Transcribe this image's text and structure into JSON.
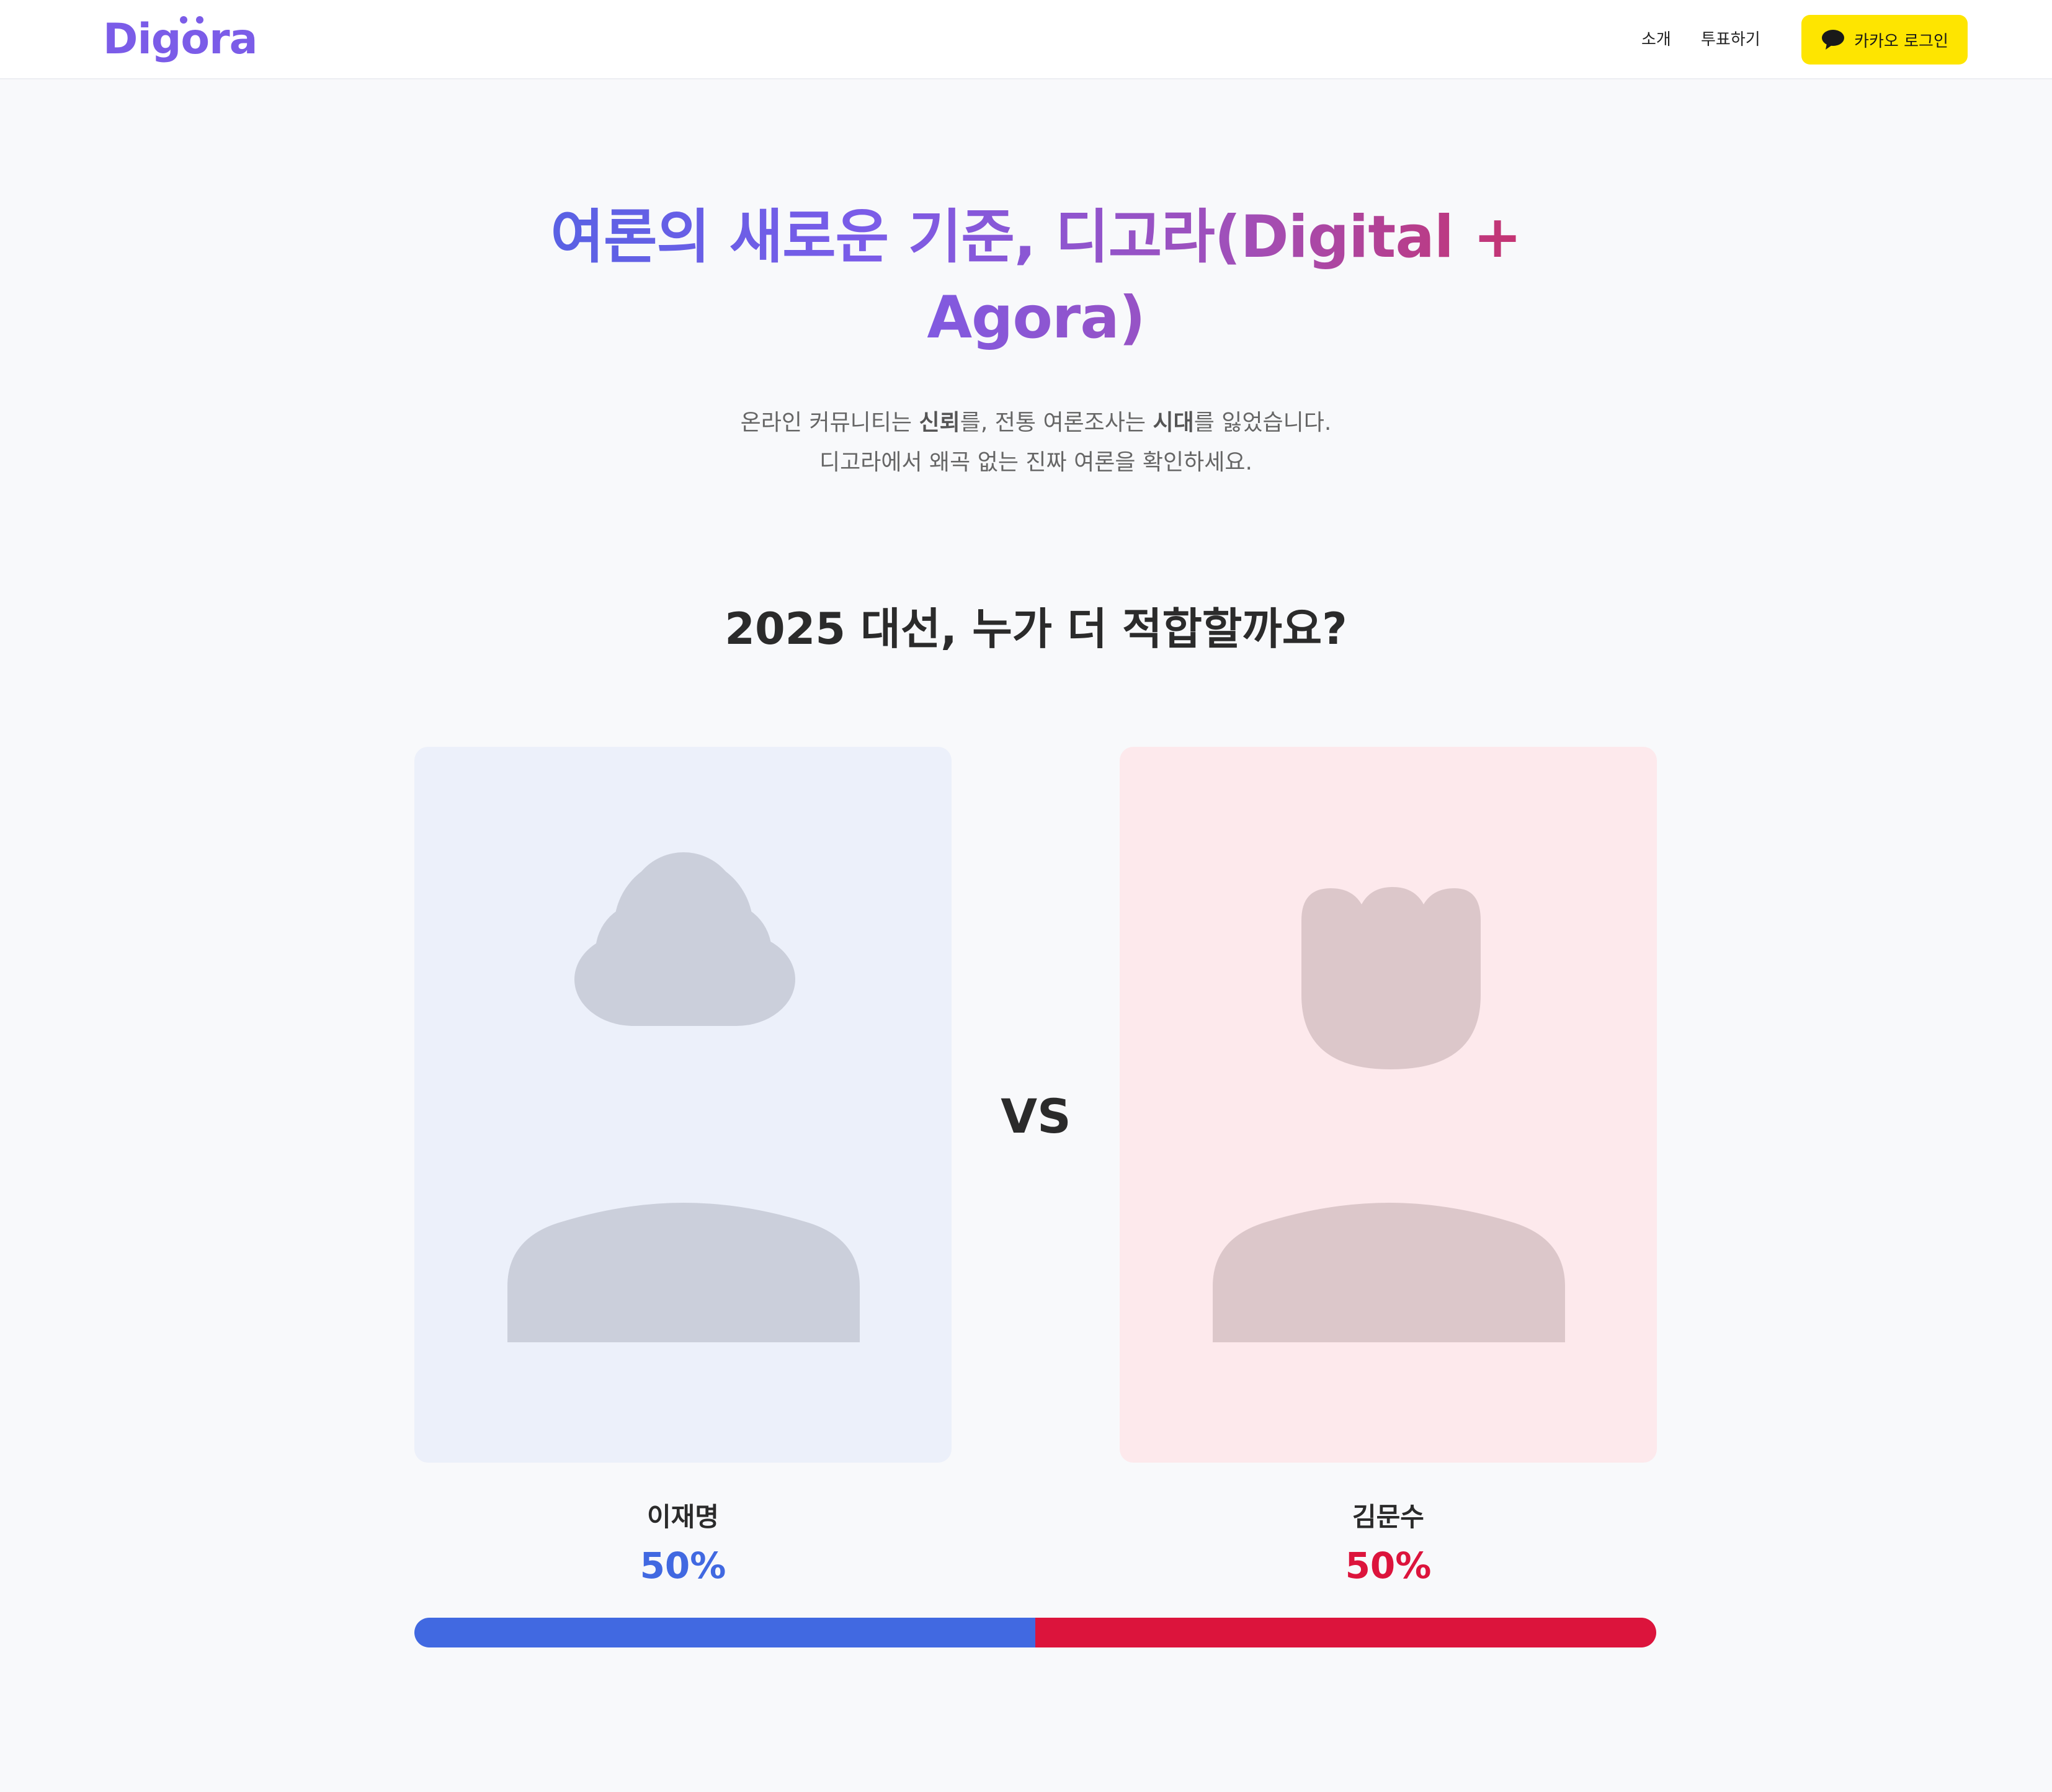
{
  "header": {
    "logo_text": "Digora",
    "nav": {
      "about_label": "소개",
      "vote_label": "투표하기"
    },
    "login_label": "카카오 로그인"
  },
  "hero": {
    "title": "여론의 새로운 기준, 디고라(Digital + Agora)",
    "line1_a": "온라인 커뮤니티는 ",
    "line1_b": "신뢰",
    "line1_c": "를, 전통 여론조사는 ",
    "line1_d": "시대",
    "line1_e": "를 잃었습니다.",
    "line2": "디고라에서 왜곡 없는 진짜 여론을 확인하세요."
  },
  "poll": {
    "question": "2025 대선, 누가 더 적합할까요?",
    "vs_label": "VS",
    "candidates": [
      {
        "name": "이재명",
        "percent_label": "50%",
        "share": 0.5,
        "color": "#4169e1"
      },
      {
        "name": "김문수",
        "percent_label": "50%",
        "share": 0.5,
        "color": "#dc143c"
      }
    ]
  },
  "colors": {
    "accent": "#7b5ce8",
    "kakao": "#fee500",
    "left_card_bg": "#ecf0fa",
    "right_card_bg": "#fde9ec"
  },
  "icons": {
    "login_icon": "speech-bubble-icon",
    "left_card_icon": "person-silhouette-icon",
    "right_card_icon": "person-silhouette-icon"
  }
}
